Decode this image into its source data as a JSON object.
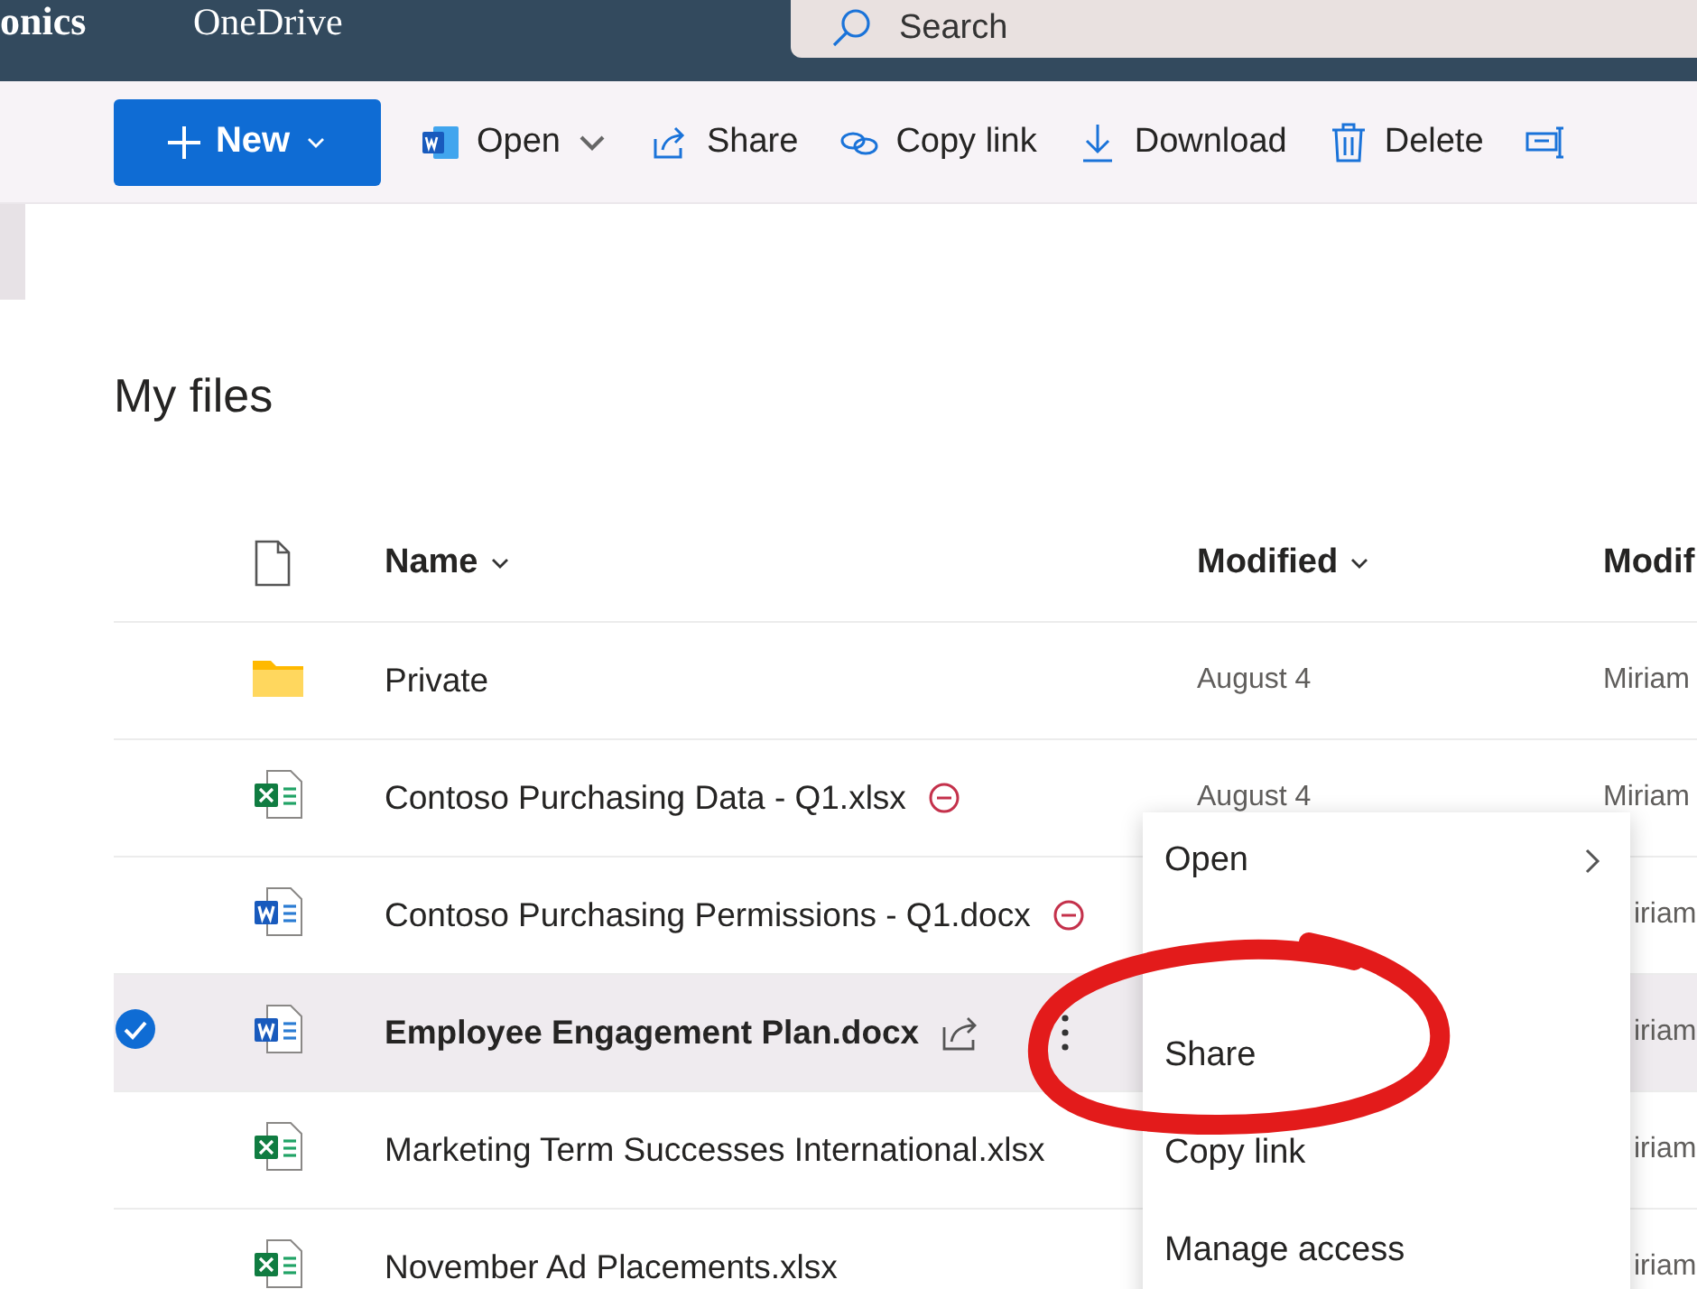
{
  "top_bar": {
    "org": "onics",
    "app": "OneDrive",
    "search": {
      "placeholder": "Search"
    }
  },
  "command_bar": {
    "new_button": "New",
    "commands": [
      {
        "kind": "word",
        "label": "Open",
        "dropdown": true
      },
      {
        "kind": "share",
        "label": "Share",
        "dropdown": false
      },
      {
        "kind": "link",
        "label": "Copy link",
        "dropdown": false
      },
      {
        "kind": "download",
        "label": "Download",
        "dropdown": false
      },
      {
        "kind": "delete",
        "label": "Delete",
        "dropdown": false
      },
      {
        "kind": "rename",
        "dropdown": false
      }
    ]
  },
  "page_title": "My files",
  "table": {
    "columns": [
      {
        "label": "Name",
        "sortable": true
      },
      {
        "label": "Modified",
        "sortable": true
      },
      {
        "label": "Modif",
        "sortable": false
      }
    ],
    "rows": [
      {
        "kind": "folder",
        "name": "Private",
        "blocked": false,
        "modified": "August 4",
        "modified_by": "Miriam",
        "selected": false,
        "behind_menu": false
      },
      {
        "kind": "excel",
        "name": "Contoso Purchasing Data - Q1.xlsx",
        "blocked": true,
        "modified": "August 4",
        "modified_by": "Miriam",
        "selected": false,
        "behind_menu": false
      },
      {
        "kind": "word",
        "name": "Contoso Purchasing Permissions - Q1.docx",
        "blocked": true,
        "modified_by": "iriam",
        "selected": false,
        "behind_menu": true
      },
      {
        "kind": "word",
        "name": "Employee Engagement Plan.docx",
        "blocked": false,
        "modified_by": "iriam",
        "selected": true,
        "behind_menu": true
      },
      {
        "kind": "excel",
        "name": "Marketing Term Successes International.xlsx",
        "blocked": false,
        "modified_by": "iriam",
        "selected": false,
        "behind_menu": true
      },
      {
        "kind": "excel",
        "name": "November Ad Placements.xlsx",
        "blocked": false,
        "modified_by": "iriam",
        "selected": false,
        "behind_menu": true
      }
    ]
  },
  "context_menu": {
    "items": [
      {
        "label": "Open",
        "submenu": true
      },
      {
        "label": "Share",
        "submenu": false
      },
      {
        "label": "Copy link",
        "submenu": false
      },
      {
        "label": "Manage access",
        "submenu": false
      }
    ]
  },
  "annotation": {
    "kind": "circle",
    "color": "#e31b1b"
  }
}
